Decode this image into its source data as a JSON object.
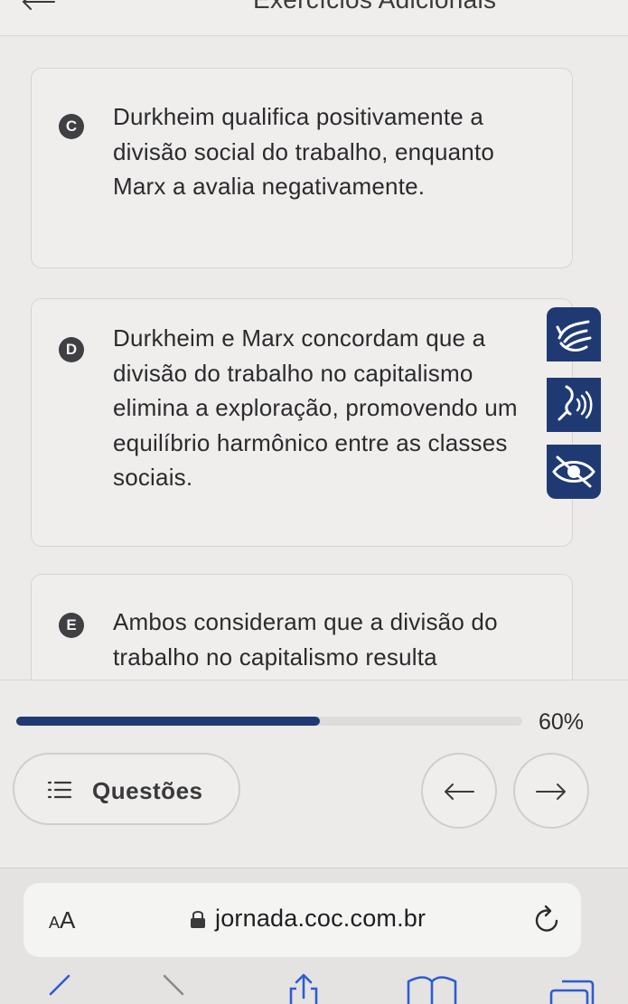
{
  "header": {
    "title": "Exercícios Adicionais"
  },
  "options": [
    {
      "letter": "C",
      "text": "Durkheim qualifica positivamente a divisão social do trabalho, enquanto Marx a avalia negativamente."
    },
    {
      "letter": "D",
      "text": "Durkheim e Marx concordam que a divisão do trabalho no capitalismo elimina a exploração, promovendo um equilíbrio harmônico entre as classes sociais."
    },
    {
      "letter": "E",
      "text": "Ambos consideram que a divisão do trabalho no capitalismo resulta"
    }
  ],
  "accessibility": {
    "icons": [
      "sign-language-icon",
      "audio-icon",
      "eye-icon"
    ],
    "color": "#1f3a73"
  },
  "progress": {
    "percent": 60,
    "label": "60%"
  },
  "navigation": {
    "questions_label": "Questões",
    "prev_icon": "arrow-left-icon",
    "next_icon": "arrow-right-icon"
  },
  "browser": {
    "aa_small": "A",
    "aa_large": "A",
    "url": "jornada.coc.com.br"
  }
}
